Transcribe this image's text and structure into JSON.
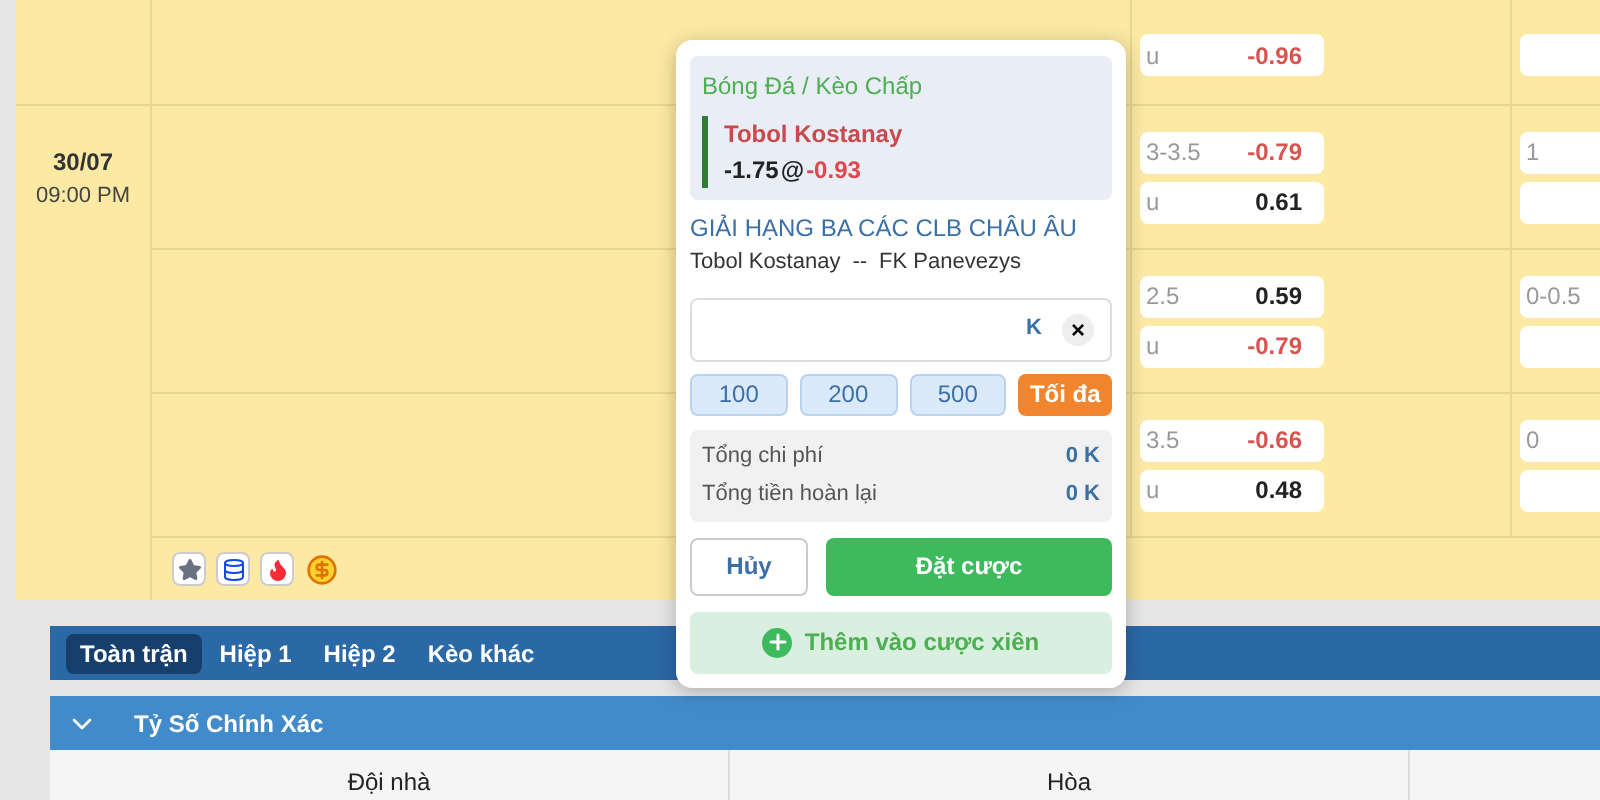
{
  "match": {
    "date": "30/07",
    "time": "09:00 PM"
  },
  "odds_rows": [
    {
      "cells": [
        {
          "line": "u",
          "price": "-0.96",
          "color": "#d9534f"
        }
      ],
      "side": [
        {
          "kind": "blank"
        }
      ]
    },
    {
      "cells": [
        {
          "line": "3-3.5",
          "price": "-0.79",
          "color": "#d9534f"
        },
        {
          "line": "u",
          "price": "0.61",
          "color": "#222222"
        }
      ],
      "side": [
        {
          "kind": "line",
          "line": "1"
        },
        {
          "kind": "blank"
        }
      ]
    },
    {
      "cells": [
        {
          "line": "2.5",
          "price": "0.59",
          "color": "#222222"
        },
        {
          "line": "u",
          "price": "-0.79",
          "color": "#d9534f"
        }
      ],
      "side": [
        {
          "kind": "line",
          "line": "0-0.5"
        },
        {
          "kind": "blank"
        }
      ]
    },
    {
      "cells": [
        {
          "line": "3.5",
          "price": "-0.66",
          "color": "#d9534f"
        },
        {
          "line": "u",
          "price": "0.48",
          "color": "#222222"
        }
      ],
      "side": [
        {
          "kind": "line",
          "line": "0"
        },
        {
          "kind": "blank"
        }
      ]
    }
  ],
  "match_icons": [
    {
      "kind": "star"
    },
    {
      "kind": "stats"
    },
    {
      "kind": "fire"
    },
    {
      "kind": "coin"
    }
  ],
  "bet_slip": {
    "category": "Bóng Đá / Kèo Chấp",
    "team": "Tobol Kostanay",
    "handicap": "-1.75",
    "at": "@",
    "price": "-0.93",
    "league": "GIẢI HẠNG BA CÁC CLB CHÂU ÂU",
    "home": "Tobol Kostanay",
    "separator": "--",
    "away": "FK Panevezys",
    "stake_unit": "K",
    "clear": "×",
    "quick_amounts": [
      {
        "label": "100",
        "kind": "amount"
      },
      {
        "label": "200",
        "kind": "amount"
      },
      {
        "label": "500",
        "kind": "amount"
      },
      {
        "label": "Tối đa",
        "kind": "max"
      }
    ],
    "summary": [
      {
        "label": "Tổng chi phí",
        "value": "0 K"
      },
      {
        "label": "Tổng tiền hoàn lại",
        "value": "0 K"
      }
    ],
    "cancel": "Hủy",
    "place": "Đặt cược",
    "add_parlay": "Thêm vào cược xiên"
  },
  "period_tabs": [
    {
      "label": "Toàn trận",
      "selected": true
    },
    {
      "label": "Hiệp 1",
      "selected": false
    },
    {
      "label": "Hiệp 2",
      "selected": false
    },
    {
      "label": "Kèo khác",
      "selected": false
    }
  ],
  "section": {
    "title": "Tỷ Số Chính Xác",
    "expanded": true,
    "columns": [
      "Đội nhà",
      "Hòa"
    ]
  }
}
